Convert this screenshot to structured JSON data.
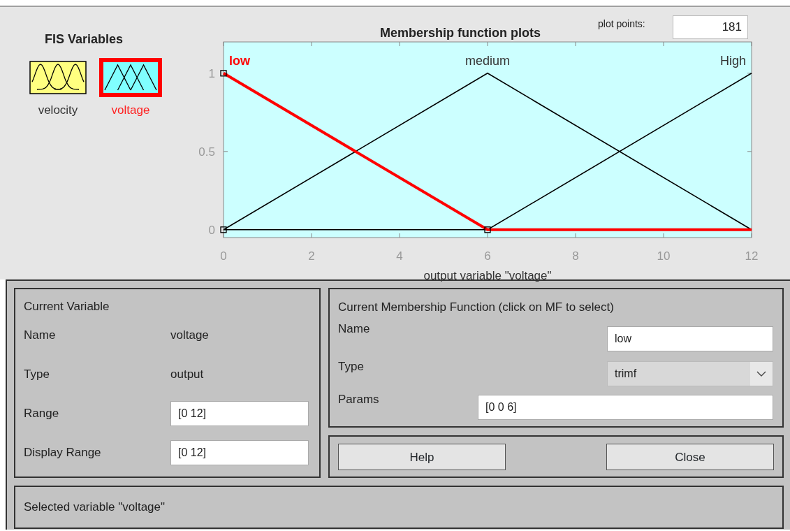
{
  "fis_variables": {
    "title": "FIS Variables",
    "items": [
      {
        "name": "velocity",
        "kind": "input",
        "selected": false
      },
      {
        "name": "voltage",
        "kind": "output",
        "selected": true
      }
    ]
  },
  "plot": {
    "title": "Membership function plots",
    "plot_points_label": "plot points:",
    "plot_points": "181",
    "chart_data": {
      "type": "line",
      "xlabel": "output variable \"voltage\"",
      "x": [
        0,
        6,
        12
      ],
      "xlim": [
        0,
        12
      ],
      "ylim": [
        -0.05,
        1.2
      ],
      "xticks": [
        0,
        2,
        4,
        6,
        8,
        10,
        12
      ],
      "yticks": [
        0,
        0.5,
        1
      ],
      "series": [
        {
          "name": "low",
          "color": "#ff0000",
          "values": [
            1,
            0,
            0
          ]
        },
        {
          "name": "medium",
          "color": "#000000",
          "values": [
            0,
            1,
            0
          ]
        },
        {
          "name": "High",
          "color": "#000000",
          "values": [
            0,
            0,
            1
          ]
        }
      ]
    },
    "membership_functions": [
      {
        "selected": true
      },
      {
        "selected": false
      },
      {
        "selected": false
      }
    ]
  },
  "current_variable": {
    "title": "Current Variable",
    "name_label": "Name",
    "name": "voltage",
    "type_label": "Type",
    "type": "output",
    "range_label": "Range",
    "range": "[0 12]",
    "display_range_label": "Display Range",
    "display_range": "[0 12]"
  },
  "current_mf": {
    "title": "Current Membership Function (click on MF to select)",
    "name_label": "Name",
    "name": "low",
    "type_label": "Type",
    "type": "trimf",
    "params_label": "Params",
    "params": "[0 0 6]"
  },
  "buttons": [
    "Help",
    "Close"
  ],
  "status_bar": "Selected variable \"voltage\""
}
